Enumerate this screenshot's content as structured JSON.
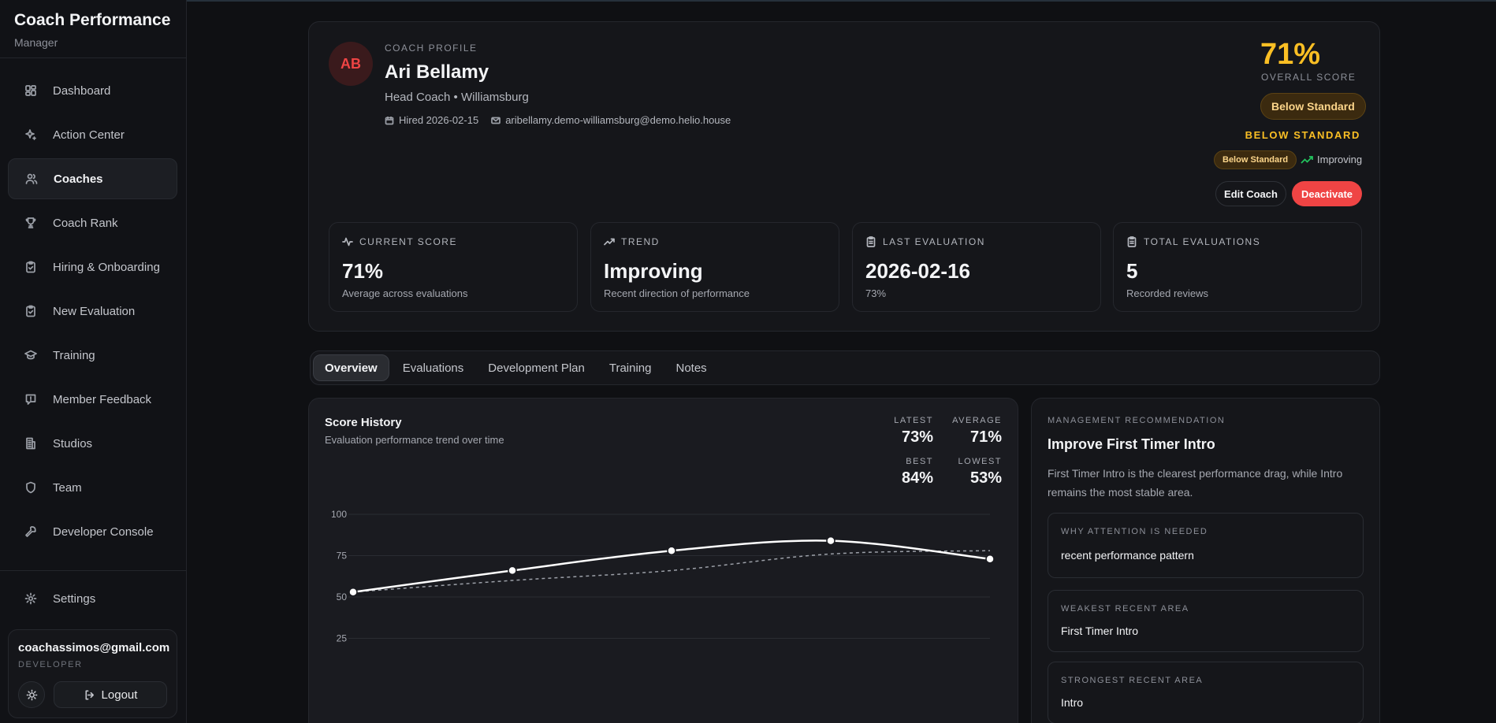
{
  "brand": {
    "title": "Coach Performance",
    "subtitle": "Manager"
  },
  "sidebar": {
    "items": [
      {
        "label": "Dashboard",
        "icon": "dashboard-icon"
      },
      {
        "label": "Action Center",
        "icon": "sparkle-icon"
      },
      {
        "label": "Coaches",
        "icon": "users-icon",
        "active": true
      },
      {
        "label": "Coach Rank",
        "icon": "trophy-icon"
      },
      {
        "label": "Hiring & Onboarding",
        "icon": "clipboard-check-icon"
      },
      {
        "label": "New Evaluation",
        "icon": "clipboard-check-icon"
      },
      {
        "label": "Training",
        "icon": "graduation-cap-icon"
      },
      {
        "label": "Member Feedback",
        "icon": "message-icon"
      },
      {
        "label": "Studios",
        "icon": "building-icon"
      },
      {
        "label": "Team",
        "icon": "shield-icon"
      },
      {
        "label": "Developer Console",
        "icon": "wrench-icon"
      }
    ],
    "settings_label": "Settings"
  },
  "user": {
    "email": "coachassimos@gmail.com",
    "role": "DEVELOPER",
    "logout_label": "Logout"
  },
  "profile": {
    "eyebrow": "COACH PROFILE",
    "initials": "AB",
    "name": "Ari Bellamy",
    "role_line": "Head Coach • Williamsburg",
    "hired": "Hired 2026-02-15",
    "email": "aribellamy.demo-williamsburg@demo.helio.house",
    "overall_score": "71%",
    "overall_label": "OVERALL SCORE",
    "status_pill": "Below Standard",
    "status_text": "BELOW STANDARD",
    "mini_pill": "Below Standard",
    "trend_label": "Improving",
    "edit_label": "Edit Coach",
    "deactivate_label": "Deactivate"
  },
  "stats": [
    {
      "label": "CURRENT SCORE",
      "value": "71%",
      "sub": "Average across evaluations",
      "icon": "activity-icon"
    },
    {
      "label": "TREND",
      "value": "Improving",
      "sub": "Recent direction of performance",
      "icon": "trending-up-icon"
    },
    {
      "label": "LAST EVALUATION",
      "value": "2026-02-16",
      "sub": "73%",
      "icon": "clipboard-icon"
    },
    {
      "label": "TOTAL EVALUATIONS",
      "value": "5",
      "sub": "Recorded reviews",
      "icon": "clipboard-icon"
    }
  ],
  "tabs": [
    {
      "label": "Overview",
      "active": true
    },
    {
      "label": "Evaluations"
    },
    {
      "label": "Development Plan"
    },
    {
      "label": "Training"
    },
    {
      "label": "Notes"
    }
  ],
  "score_history": {
    "title": "Score History",
    "subtitle": "Evaluation performance trend over time",
    "kpis": [
      {
        "label": "LATEST",
        "value": "73%"
      },
      {
        "label": "AVERAGE",
        "value": "71%"
      },
      {
        "label": "BEST",
        "value": "84%"
      },
      {
        "label": "LOWEST",
        "value": "53%"
      }
    ]
  },
  "chart_data": {
    "type": "line",
    "title": "Score History",
    "subtitle": "Evaluation performance trend over time",
    "x": [
      1,
      2,
      3,
      4,
      5
    ],
    "series": [
      {
        "values": [
          53,
          66,
          78,
          84,
          73
        ],
        "style": "solid",
        "color": "#ffffff"
      },
      {
        "values": [
          53,
          60,
          66,
          76,
          78
        ],
        "style": "dashed",
        "color": "#9ca0a8"
      }
    ],
    "ylim": [
      0,
      100
    ],
    "yticks": [
      25,
      50,
      75,
      100
    ],
    "grid": true
  },
  "recommendation": {
    "eyebrow": "MANAGEMENT RECOMMENDATION",
    "title": "Improve First Timer Intro",
    "body": "First Timer Intro is the clearest performance drag, while Intro remains the most stable area.",
    "boxes": [
      {
        "label": "WHY ATTENTION IS NEEDED",
        "value": "recent performance pattern"
      },
      {
        "label": "WEAKEST RECENT AREA",
        "value": "First Timer Intro"
      },
      {
        "label": "STRONGEST RECENT AREA",
        "value": "Intro"
      }
    ]
  },
  "colors": {
    "accent_warning": "#fbbf24",
    "danger": "#ef4444",
    "success": "#22c55e",
    "background": "#0f1013"
  }
}
